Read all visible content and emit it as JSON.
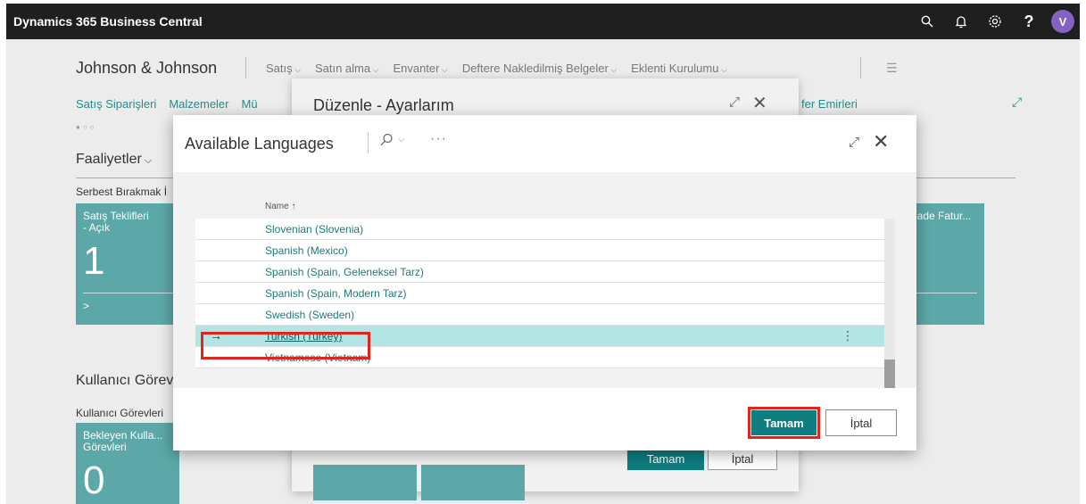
{
  "topbar": {
    "brand": "Dynamics 365 Business Central",
    "icons": [
      "search-icon",
      "bell-icon",
      "gear-icon",
      "help-icon"
    ],
    "avatar_initial": "V"
  },
  "background": {
    "company": "Johnson & Johnson",
    "menu": [
      "Satış",
      "Satın alma",
      "Envanter",
      "Deftere Nakledilmiş Belgeler",
      "Eklenti Kurulumu"
    ],
    "actions": [
      "Satış Siparişleri",
      "Malzemeler",
      "Mü"
    ],
    "faaliyetler": "Faaliyetler",
    "serbest": "Serbest Bırakmak İ",
    "tile1_label": "Satış Teklifleri - Açık",
    "tile1_value": "1",
    "tile_right_label": "lade Fatur...",
    "kullanici_header": "Kullanıcı Görev",
    "kullanici_sub": "Kullanıcı Görevleri",
    "tile2_label": "Bekleyen Kulla... Görevleri",
    "tile2_value": "0"
  },
  "mid_dialog": {
    "title": "Düzenle - Ayarlarım",
    "right_link": "fer Emirleri",
    "ok": "Tamam",
    "cancel": "İptal"
  },
  "dialog": {
    "title": "Available Languages",
    "column_header": "Name ↑",
    "rows": [
      "Slovenian (Slovenia)",
      "Spanish (Mexico)",
      "Spanish (Spain, Geleneksel Tarz)",
      "Spanish (Spain, Modern Tarz)",
      "Swedish (Sweden)",
      "Turkish (Turkey)",
      "Vietnamese (Vietnam)"
    ],
    "selected_row": "Turkish (Turkey)",
    "ok": "Tamam",
    "cancel": "İptal"
  },
  "colors": {
    "accent": "#0f7e80",
    "highlight": "#e0251f",
    "selection": "#b3e5e5"
  }
}
